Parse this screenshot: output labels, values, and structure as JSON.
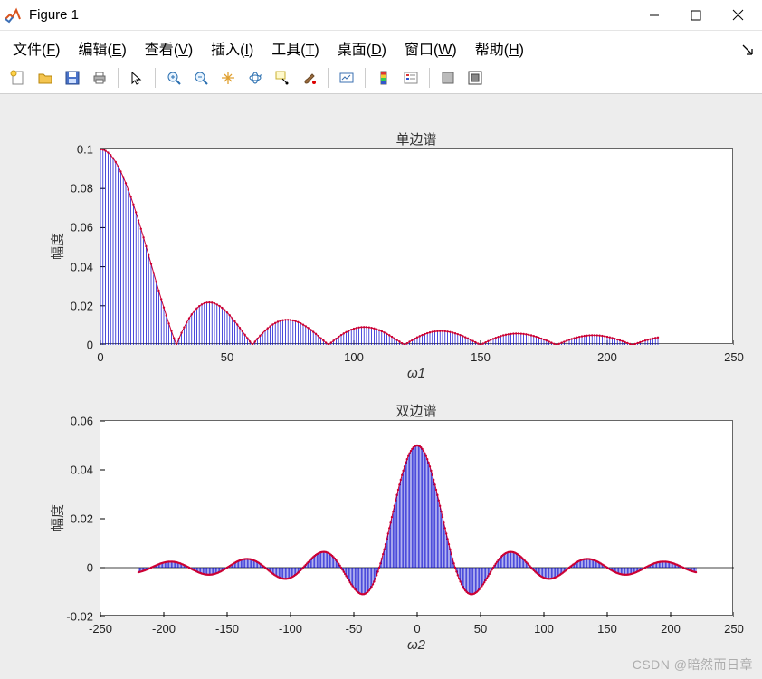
{
  "window": {
    "title": "Figure 1"
  },
  "menu": {
    "items": [
      {
        "label": "文件",
        "accel": "F"
      },
      {
        "label": "编辑",
        "accel": "E"
      },
      {
        "label": "查看",
        "accel": "V"
      },
      {
        "label": "插入",
        "accel": "I"
      },
      {
        "label": "工具",
        "accel": "T"
      },
      {
        "label": "桌面",
        "accel": "D"
      },
      {
        "label": "窗口",
        "accel": "W"
      },
      {
        "label": "帮助",
        "accel": "H"
      }
    ]
  },
  "toolbar": {
    "buttons": [
      "new",
      "open",
      "save",
      "print",
      "|",
      "pointer",
      "|",
      "zoom-in",
      "zoom-out",
      "pan",
      "rotate",
      "data-cursor",
      "brush",
      "|",
      "link",
      "|",
      "colorbar",
      "legend",
      "|",
      "insert-axes",
      "dock"
    ]
  },
  "watermark": "CSDN @暗然而日章",
  "chart_data": [
    {
      "type": "stem",
      "title": "单边谱",
      "xlabel": "ω1",
      "ylabel": "幅度",
      "xlim": [
        0,
        250
      ],
      "ylim": [
        0,
        0.1
      ],
      "xticks": [
        0,
        50,
        100,
        150,
        200,
        250
      ],
      "yticks": [
        0,
        0.02,
        0.04,
        0.06,
        0.08,
        0.1
      ],
      "formula": "|sinc(x/30)| * 0.1 approx",
      "zeros_at": [
        30,
        60,
        90,
        120,
        150,
        180,
        210
      ],
      "lobe_peaks": [
        {
          "x": 0,
          "y": 0.1
        },
        {
          "x": 45,
          "y": 0.022
        },
        {
          "x": 75,
          "y": 0.013
        },
        {
          "x": 105,
          "y": 0.009
        },
        {
          "x": 135,
          "y": 0.007
        },
        {
          "x": 165,
          "y": 0.006
        },
        {
          "x": 195,
          "y": 0.005
        }
      ],
      "n_points": 221,
      "stem_color": "#0000cc",
      "marker_color": "#cc0033"
    },
    {
      "type": "stem",
      "title": "双边谱",
      "xlabel": "ω2",
      "ylabel": "幅度",
      "xlim": [
        -250,
        250
      ],
      "ylim": [
        -0.02,
        0.06
      ],
      "xticks": [
        -250,
        -200,
        -150,
        -100,
        -50,
        0,
        50,
        100,
        150,
        200,
        250
      ],
      "yticks": [
        -0.02,
        0,
        0.02,
        0.04,
        0.06
      ],
      "formula": "sinc(x/30) * 0.05 approx",
      "zeros_at": [
        -210,
        -180,
        -150,
        -120,
        -90,
        -60,
        -30,
        30,
        60,
        90,
        120,
        150,
        180,
        210
      ],
      "lobe_peaks": [
        {
          "x": -195,
          "y": 0.002
        },
        {
          "x": -165,
          "y": -0.003
        },
        {
          "x": -135,
          "y": 0.003
        },
        {
          "x": -105,
          "y": -0.005
        },
        {
          "x": -75,
          "y": 0.007
        },
        {
          "x": -45,
          "y": -0.011
        },
        {
          "x": 0,
          "y": 0.05
        },
        {
          "x": 45,
          "y": -0.011
        },
        {
          "x": 75,
          "y": 0.007
        },
        {
          "x": 105,
          "y": -0.005
        },
        {
          "x": 135,
          "y": 0.003
        },
        {
          "x": 165,
          "y": -0.003
        },
        {
          "x": 195,
          "y": 0.002
        }
      ],
      "n_points": 441,
      "stem_color": "#0000cc",
      "marker_color": "#cc0033"
    }
  ]
}
